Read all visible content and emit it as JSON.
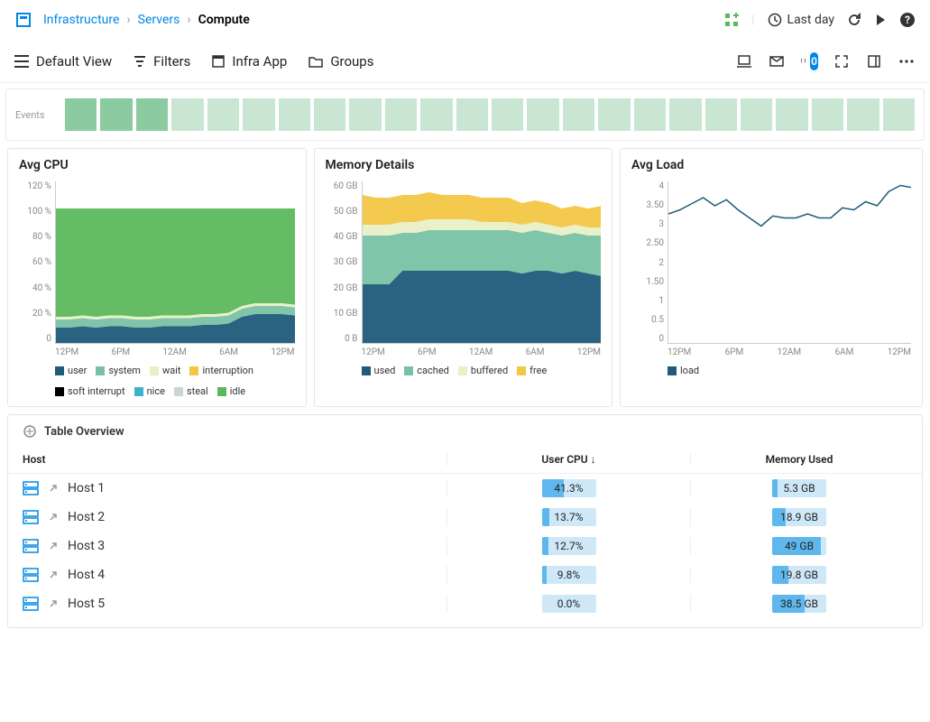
{
  "breadcrumb": {
    "root": "Infrastructure",
    "second": "Servers",
    "current": "Compute"
  },
  "time_range": "Last day",
  "toolbar": {
    "view": "Default View",
    "filters": "Filters",
    "infra_app": "Infra App",
    "groups": "Groups",
    "alert_count": "0"
  },
  "events_label": "Events",
  "events_on": [
    true,
    true,
    true,
    false,
    false,
    false,
    false,
    false,
    false,
    false,
    false,
    false,
    false,
    false,
    false,
    false,
    false,
    false,
    false,
    false,
    false,
    false,
    false,
    false
  ],
  "chart_data": [
    {
      "type": "area",
      "title": "Avg CPU",
      "ylim": [
        0,
        120
      ],
      "yunit": "%",
      "yticks": [
        "120 %",
        "100 %",
        "80 %",
        "60 %",
        "40 %",
        "20 %",
        "0"
      ],
      "xticks": [
        "12PM",
        "6PM",
        "12AM",
        "6AM",
        "12PM"
      ],
      "series": [
        {
          "name": "user",
          "color": "#1f5b7a",
          "values": [
            12,
            12,
            13,
            12,
            13,
            13,
            12,
            12,
            13,
            13,
            13,
            14,
            14,
            15,
            20,
            22,
            22,
            22,
            21
          ]
        },
        {
          "name": "system",
          "color": "#78c2a4",
          "values": [
            6,
            6,
            6,
            6,
            6,
            6,
            6,
            6,
            6,
            6,
            6,
            6,
            6,
            6,
            6,
            6,
            6,
            6,
            6
          ]
        },
        {
          "name": "wait",
          "color": "#e9efc6",
          "values": [
            2,
            2,
            2,
            2,
            2,
            2,
            2,
            2,
            2,
            2,
            2,
            2,
            2,
            2,
            2,
            2,
            2,
            2,
            2
          ]
        },
        {
          "name": "interruption",
          "color": "#f3c744",
          "values": [
            0,
            0,
            0,
            0,
            0,
            0,
            0,
            0,
            0,
            0,
            0,
            0,
            0,
            0,
            0,
            0,
            0,
            0,
            0
          ]
        },
        {
          "name": "soft interrupt",
          "color": "#000",
          "values": [
            0,
            0,
            0,
            0,
            0,
            0,
            0,
            0,
            0,
            0,
            0,
            0,
            0,
            0,
            0,
            0,
            0,
            0,
            0
          ]
        },
        {
          "name": "nice",
          "color": "#3bb2d0",
          "values": [
            0,
            0,
            0,
            0,
            0,
            0,
            0,
            0,
            0,
            0,
            0,
            0,
            0,
            0,
            0,
            0,
            0,
            0,
            0
          ]
        },
        {
          "name": "steal",
          "color": "#cbd5d1",
          "values": [
            0,
            0,
            0,
            0,
            0,
            0,
            0,
            0,
            0,
            0,
            0,
            0,
            0,
            0,
            0,
            0,
            0,
            0,
            0
          ]
        },
        {
          "name": "idle",
          "color": "#5cb85c",
          "values": [
            80,
            80,
            79,
            80,
            79,
            79,
            80,
            80,
            79,
            79,
            79,
            78,
            78,
            77,
            72,
            70,
            70,
            70,
            71
          ]
        }
      ]
    },
    {
      "type": "area",
      "title": "Memory Details",
      "ylim": [
        0,
        60
      ],
      "yunit": "GB",
      "yticks": [
        "60 GB",
        "50 GB",
        "40 GB",
        "30 GB",
        "20 GB",
        "10 GB",
        "0 B"
      ],
      "xticks": [
        "12PM",
        "6PM",
        "12AM",
        "6AM",
        "12PM"
      ],
      "series": [
        {
          "name": "used",
          "color": "#1f5b7a",
          "values": [
            22,
            22,
            22,
            27,
            27,
            27,
            27,
            27,
            27,
            27,
            27,
            27,
            26,
            27,
            27,
            26,
            27,
            26,
            25
          ]
        },
        {
          "name": "cached",
          "color": "#78c2a4",
          "values": [
            18,
            18,
            18,
            14,
            14,
            15,
            15,
            15,
            15,
            15,
            15,
            15,
            15,
            15,
            14,
            14,
            14,
            14,
            15
          ]
        },
        {
          "name": "buffered",
          "color": "#e9efc6",
          "values": [
            4,
            4,
            4,
            4,
            4,
            4,
            4,
            4,
            4,
            3,
            3,
            3,
            3,
            3,
            3,
            3,
            3,
            3,
            3
          ]
        },
        {
          "name": "free",
          "color": "#f3c744",
          "values": [
            11,
            10,
            10,
            10,
            10,
            10,
            9,
            9,
            9,
            9,
            9,
            9,
            8,
            8,
            8,
            7,
            7,
            7,
            8
          ]
        }
      ]
    },
    {
      "type": "line",
      "title": "Avg Load",
      "ylim": [
        0,
        4
      ],
      "yticks": [
        "4",
        "3.50",
        "3",
        "2.50",
        "2",
        "1.50",
        "1",
        "0.5",
        "0"
      ],
      "xticks": [
        "12PM",
        "6PM",
        "12AM",
        "6AM",
        "12PM"
      ],
      "series": [
        {
          "name": "load",
          "color": "#1f5b7a",
          "values": [
            3.2,
            3.3,
            3.45,
            3.6,
            3.4,
            3.55,
            3.3,
            3.1,
            2.9,
            3.15,
            3.1,
            3.1,
            3.2,
            3.1,
            3.1,
            3.35,
            3.3,
            3.5,
            3.4,
            3.75,
            3.9,
            3.85
          ]
        }
      ]
    }
  ],
  "table": {
    "title": "Table Overview",
    "cols": {
      "host": "Host",
      "cpu": "User CPU ↓",
      "mem": "Memory Used"
    },
    "rows": [
      {
        "host": "Host 1",
        "cpu": "41.3%",
        "cpu_fill": 41.3,
        "mem": "5.3 GB",
        "mem_fill": 10
      },
      {
        "host": "Host 2",
        "cpu": "13.7%",
        "cpu_fill": 13.7,
        "mem": "18.9 GB",
        "mem_fill": 25
      },
      {
        "host": "Host 3",
        "cpu": "12.7%",
        "cpu_fill": 12.7,
        "mem": "49 GB",
        "mem_fill": 90
      },
      {
        "host": "Host 4",
        "cpu": "9.8%",
        "cpu_fill": 9.8,
        "mem": "19.8 GB",
        "mem_fill": 30
      },
      {
        "host": "Host 5",
        "cpu": "0.0%",
        "cpu_fill": 0,
        "mem": "38.5 GB",
        "mem_fill": 60
      }
    ]
  }
}
